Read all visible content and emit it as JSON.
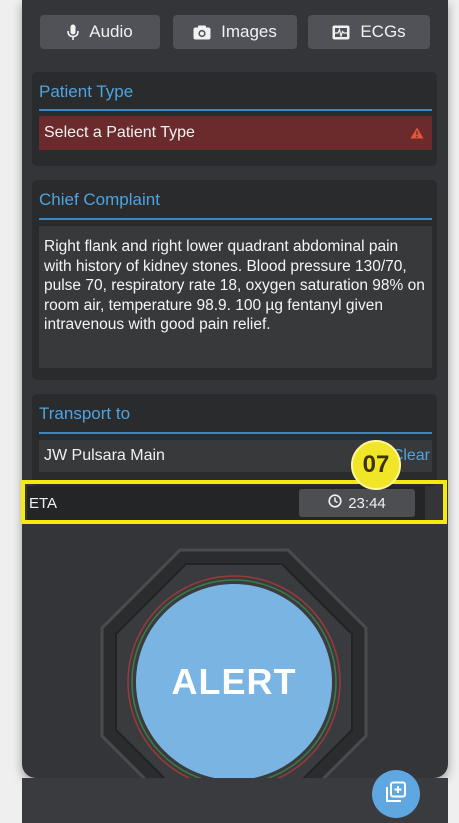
{
  "top_buttons": {
    "audio": "Audio",
    "images": "Images",
    "ecgs": "ECGs"
  },
  "patient_type": {
    "title": "Patient Type",
    "placeholder": "Select a Patient Type"
  },
  "chief_complaint": {
    "title": "Chief Complaint",
    "text": "Right flank and right lower quadrant abdominal pain with history of kidney stones. Blood pressure 130/70, pulse 70, respiratory rate 18, oxygen saturation 98% on room air, temperature 98.9. 100 µg fentanyl given intravenous with good pain relief."
  },
  "transport": {
    "title": "Transport to",
    "destination": "JW Pulsara Main",
    "clear_label": "Clear"
  },
  "eta": {
    "label": "ETA",
    "time": "23:44"
  },
  "callout": {
    "number": "07"
  },
  "alert": {
    "label": "ALERT"
  },
  "colors": {
    "accent_blue": "#4ea3e0",
    "warning_red": "#6b2a2b",
    "highlight_yellow": "#f5ea0a",
    "alert_button": "#7ab4e2"
  },
  "icons": [
    "microphone-icon",
    "camera-icon",
    "ecg-icon",
    "warning-icon",
    "clock-icon",
    "add-copy-icon"
  ]
}
